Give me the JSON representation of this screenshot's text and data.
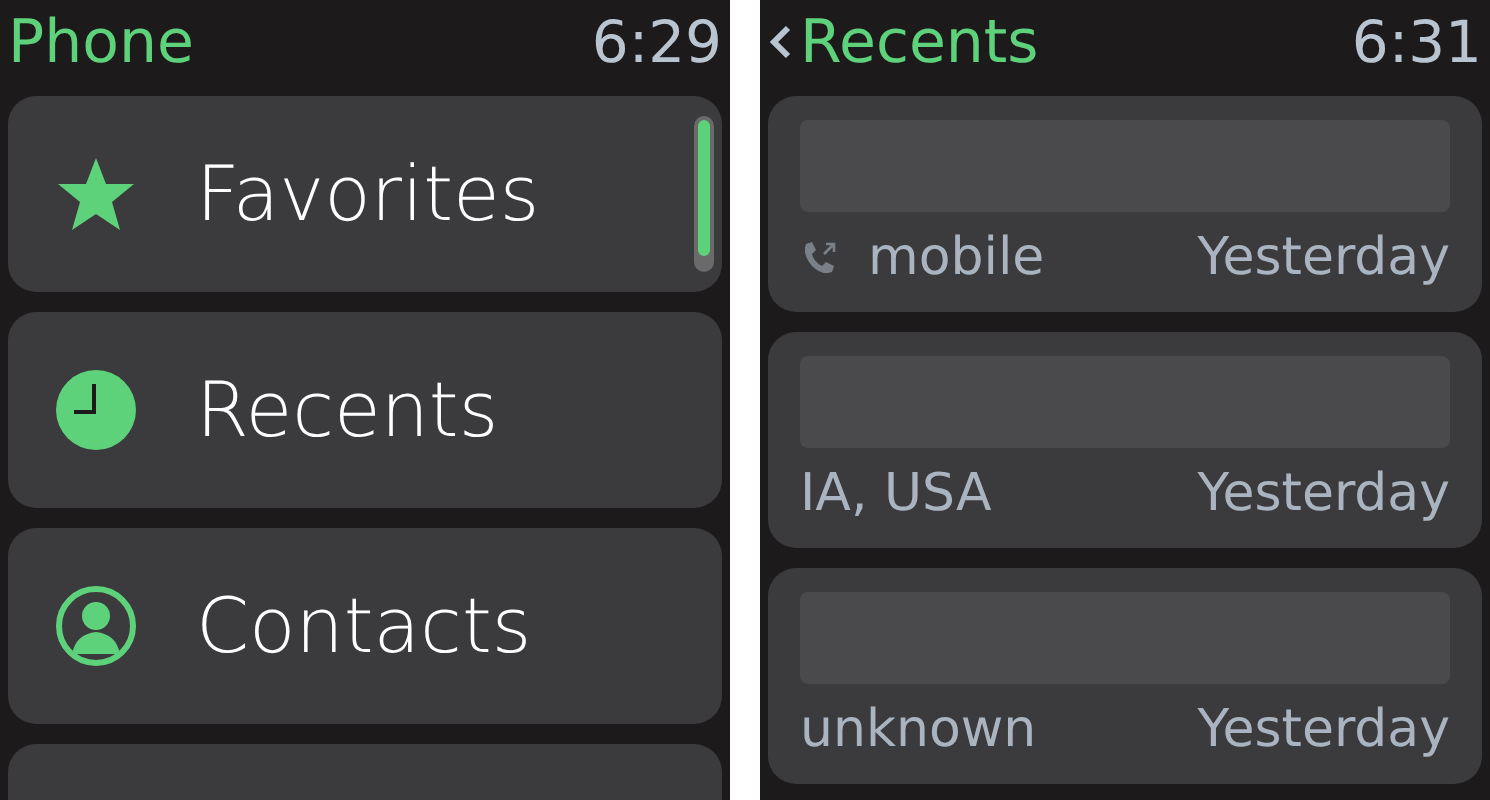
{
  "screens": [
    {
      "title": "Phone",
      "time": "6:29",
      "back": false,
      "menu": [
        {
          "kind": "star",
          "label": "Favorites"
        },
        {
          "kind": "clock",
          "label": "Recents"
        },
        {
          "kind": "contact",
          "label": "Contacts"
        }
      ],
      "more_below": true
    },
    {
      "title": "Recents",
      "time": "6:31",
      "back": true,
      "calls": [
        {
          "call_icon": true,
          "detail": "mobile",
          "when": "Yesterday"
        },
        {
          "call_icon": false,
          "detail": "IA, USA",
          "when": "Yesterday"
        },
        {
          "call_icon": false,
          "detail": "unknown",
          "when": "Yesterday"
        }
      ]
    }
  ]
}
